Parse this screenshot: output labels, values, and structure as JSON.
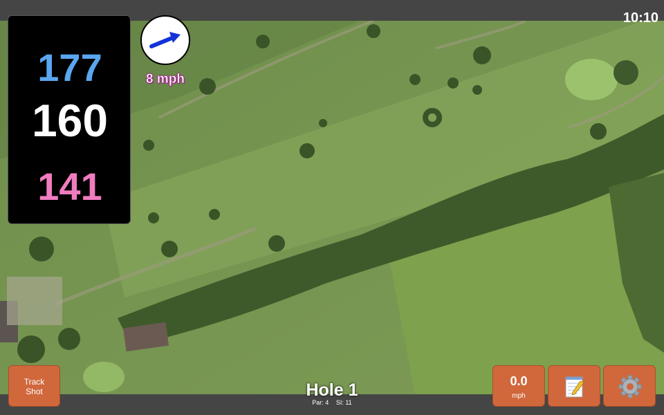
{
  "status_bar": {
    "time": "10:10"
  },
  "distances": {
    "back": "177",
    "middle": "160",
    "front": "141"
  },
  "wind": {
    "speed_text": "8 mph",
    "direction_icon": "wind-arrow-icon"
  },
  "buttons": {
    "track_shot": "Track\nShot",
    "speed_value": "0.0",
    "speed_unit": "mph",
    "notes_icon": "notepad-icon",
    "settings_icon": "gear-icon"
  },
  "hole": {
    "title": "Hole 1",
    "par": "Par: 4",
    "si": "SI: 11"
  },
  "colors": {
    "back": "#5aa6f0",
    "middle": "#ffffff",
    "front": "#f07cc0",
    "button": "#d0683c",
    "wind_text_outline": "#b01a9a"
  }
}
